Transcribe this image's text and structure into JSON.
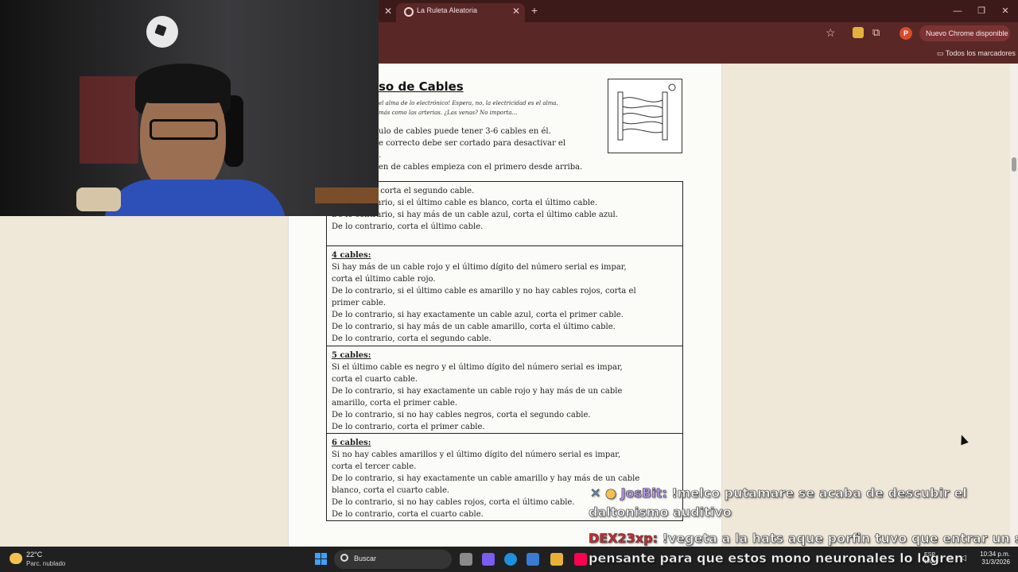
{
  "browser": {
    "tab_title": "La Ruleta Aleatoria",
    "update_button": "Nuevo Chrome disponible",
    "profile_initial": "P",
    "bookmarks_folder": "Todos los marcadores"
  },
  "document": {
    "title": "so de Cables",
    "quote_lines": [
      "el alma de lo electrónico! Espera, no, la electricidad es el alma.",
      "más como las arterias. ¿Las venas? No importa..."
    ],
    "intro_lines": [
      "ulo de cables puede tener 3-6 cables en él.",
      "e correcto debe ser cortado para desactivar el",
      ".",
      "en de cables empieza con el primero desde arriba."
    ],
    "sections": [
      {
        "label": "",
        "lines": [
          "ables rojos, corta el segundo cable.",
          "De lo contrario, si el último cable es blanco, corta el último cable.",
          "De lo contrario, si hay más de un cable azul, corta el último cable azul.",
          "De lo contrario, corta el último cable."
        ]
      },
      {
        "label": "4 cables:",
        "lines": [
          "Si hay más de un cable rojo y el último dígito del número serial es impar,",
          "corta el último cable rojo.",
          "De lo contrario, si el último cable es amarillo y no hay cables rojos, corta el",
          "primer cable.",
          "De lo contrario, si hay exactamente un cable azul, corta el primer cable.",
          "De lo contrario, si hay más de un cable amarillo, corta el último cable.",
          "De lo contrario, corta el segundo cable."
        ]
      },
      {
        "label": "5 cables:",
        "lines": [
          "Si el último cable es negro y el último dígito del número serial es impar,",
          "corta el cuarto cable.",
          "De lo contrario, si hay exactamente un cable rojo y hay más de un cable",
          "amarillo, corta el primer cable.",
          "De lo contrario, si no hay cables negros, corta el segundo cable.",
          "De lo contrario, corta el primer cable."
        ]
      },
      {
        "label": "6 cables:",
        "lines": [
          "Si no hay cables amarillos y el último dígito del número serial es impar,",
          "corta el tercer cable.",
          "De lo contrario, si hay exactamente un cable amarillo y hay más de un cable",
          "blanco, corta el cuarto cable.",
          "De lo contrario, si no hay cables rojos, corta el último cable.",
          "De lo contrario, corta el cuarto cable."
        ]
      }
    ]
  },
  "chat": {
    "msg1_user": "JosBit:",
    "msg1_text": "!melco putamare se acaba de descubir el",
    "msg1_text2": "daltonismo auditivo",
    "msg2_user": "DEX23xp:",
    "msg2_text": "!vegeta a la hats aque porfin tuvo que entrar un ser",
    "msg2_text2": "pensante para que estos mono neuronales lo logren"
  },
  "taskbar": {
    "temperature": "22°C",
    "weather": "Parc. nublado",
    "search_label": "Buscar",
    "lang_line1": "ESP",
    "lang_line2": "LAA",
    "time": "10:34 p.m.",
    "date": "31/3/2026"
  }
}
